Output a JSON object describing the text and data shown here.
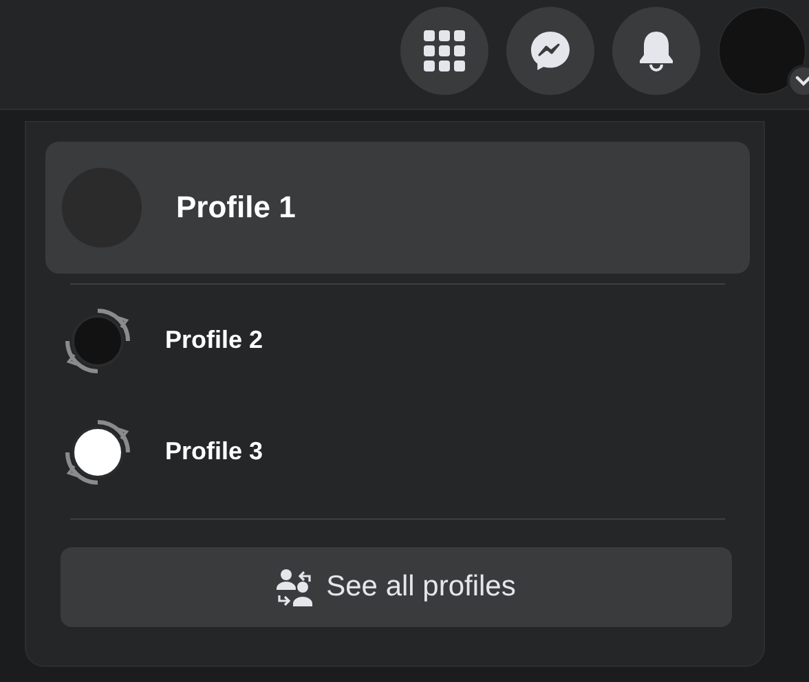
{
  "profiles": [
    {
      "name": "Profile 1",
      "selected": true,
      "color": "#2b2b2b"
    },
    {
      "name": "Profile 2",
      "selected": false,
      "color": "#121212"
    },
    {
      "name": "Profile 3",
      "selected": false,
      "color": "#ffffff"
    }
  ],
  "see_all_button": {
    "label": "See all profiles"
  }
}
